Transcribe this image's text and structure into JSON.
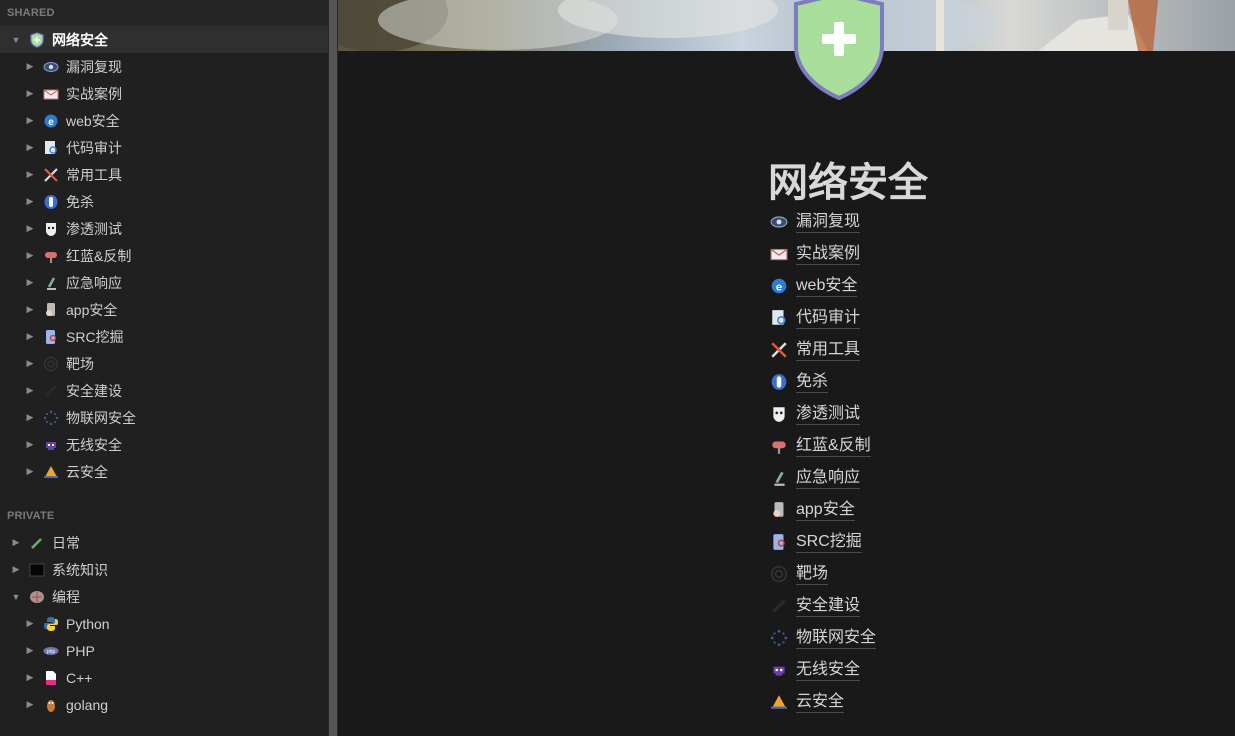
{
  "sidebar": {
    "shared_label": "SHARED",
    "private_label": "PRIVATE",
    "root": {
      "label": "网络安全",
      "icon": "shield-icon"
    },
    "shared_children": [
      {
        "label": "漏洞复现",
        "icon": "eye-icon"
      },
      {
        "label": "实战案例",
        "icon": "envelope-icon"
      },
      {
        "label": "web安全",
        "icon": "browser-e-icon"
      },
      {
        "label": "代码审计",
        "icon": "document-search-icon"
      },
      {
        "label": "常用工具",
        "icon": "tools-icon"
      },
      {
        "label": "免杀",
        "icon": "capsule-icon"
      },
      {
        "label": "渗透测试",
        "icon": "mask-icon"
      },
      {
        "label": "红蓝&反制",
        "icon": "mailbox-icon"
      },
      {
        "label": "应急响应",
        "icon": "microscope-icon"
      },
      {
        "label": "app安全",
        "icon": "phone-hand-icon"
      },
      {
        "label": "SRC挖掘",
        "icon": "phone-search-icon"
      },
      {
        "label": "靶场",
        "icon": "target-icon"
      },
      {
        "label": "安全建设",
        "icon": "blank-icon"
      },
      {
        "label": "物联网安全",
        "icon": "network-dots-icon"
      },
      {
        "label": "无线安全",
        "icon": "alien-icon"
      },
      {
        "label": "云安全",
        "icon": "cone-icon"
      }
    ],
    "private_items": [
      {
        "label": "日常",
        "icon": "pen-icon"
      },
      {
        "label": "系统知识",
        "icon": "terminal-icon"
      },
      {
        "label": "编程",
        "icon": "brain-icon"
      }
    ],
    "programming_children": [
      {
        "label": "Python",
        "icon": "python-icon"
      },
      {
        "label": "PHP",
        "icon": "php-icon"
      },
      {
        "label": "C++",
        "icon": "file-pink-icon"
      },
      {
        "label": "golang",
        "icon": "gopher-icon"
      }
    ]
  },
  "page": {
    "title": "网络安全",
    "links": [
      {
        "label": "漏洞复现",
        "icon": "eye-icon"
      },
      {
        "label": "实战案例",
        "icon": "envelope-icon"
      },
      {
        "label": "web安全",
        "icon": "browser-e-icon"
      },
      {
        "label": "代码审计",
        "icon": "document-search-icon"
      },
      {
        "label": "常用工具",
        "icon": "tools-icon"
      },
      {
        "label": "免杀",
        "icon": "capsule-icon"
      },
      {
        "label": "渗透测试",
        "icon": "mask-icon"
      },
      {
        "label": "红蓝&反制",
        "icon": "mailbox-icon"
      },
      {
        "label": "应急响应",
        "icon": "microscope-icon"
      },
      {
        "label": "app安全",
        "icon": "phone-hand-icon"
      },
      {
        "label": "SRC挖掘",
        "icon": "phone-search-icon"
      },
      {
        "label": "靶场",
        "icon": "target-icon"
      },
      {
        "label": "安全建设",
        "icon": "blank-icon"
      },
      {
        "label": "物联网安全",
        "icon": "network-dots-icon"
      },
      {
        "label": "无线安全",
        "icon": "alien-icon"
      },
      {
        "label": "云安全",
        "icon": "cone-icon"
      }
    ]
  },
  "colors": {
    "background": "#191919",
    "sidebar": "#202020",
    "text": "#d6d6d6",
    "shield_fill": "#a8e0a0",
    "shield_border": "#7a78b8"
  }
}
